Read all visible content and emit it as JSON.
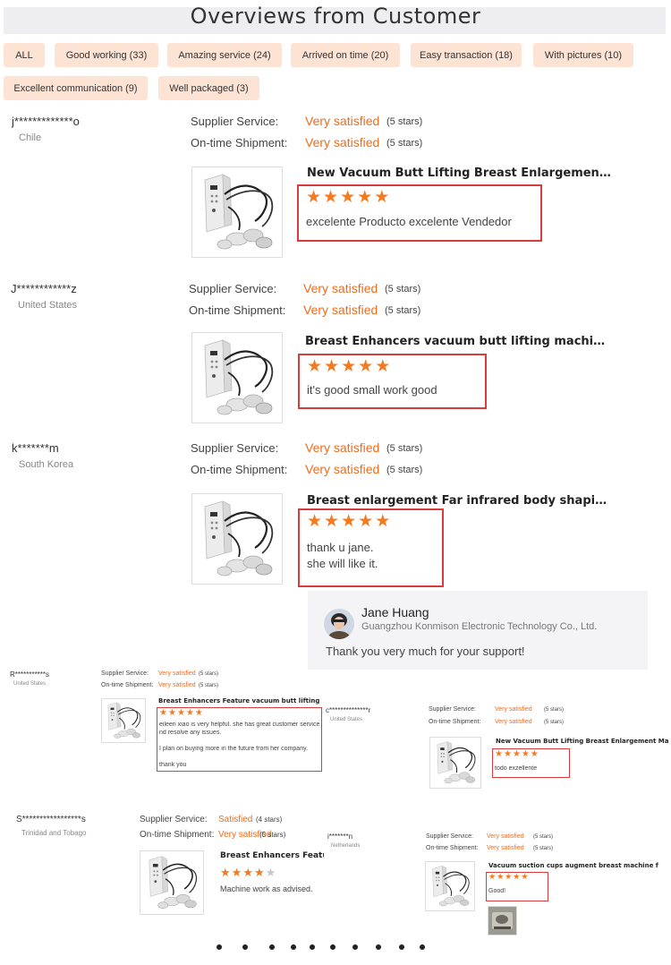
{
  "header": {
    "title": "Overviews from Customer"
  },
  "filters": [
    {
      "label": "ALL"
    },
    {
      "label": "Good working (33)"
    },
    {
      "label": "Amazing service (24)"
    },
    {
      "label": "Arrived on time (20)"
    },
    {
      "label": "Easy transaction (18)"
    },
    {
      "label": "With pictures (10)"
    },
    {
      "label": "Excellent communication (9)"
    },
    {
      "label": "Well packaged (3)"
    }
  ],
  "labels": {
    "supplier_service": "Supplier Service:",
    "ontime_shipment": "On-time Shipment:"
  },
  "reviews": [
    {
      "name": "j*************o",
      "country": "Chile",
      "supplier": "Very satisfied",
      "supplier_stars": "(5 stars)",
      "shipment": "Very satisfied",
      "shipment_stars": "(5 stars)",
      "product": "New Vacuum Butt Lifting Breast Enlargement Machin...",
      "rating": 5,
      "comment": [
        "excelente Producto  excelente  Vendedor"
      ]
    },
    {
      "name": "J************z",
      "country": "United States",
      "supplier": "Very satisfied",
      "supplier_stars": "(5 stars)",
      "shipment": "Very satisfied",
      "shipment_stars": "(5 stars)",
      "product": "Breast Enhancers vacuum butt lifting machine cups v...",
      "rating": 5,
      "comment": [
        "it's good small work good"
      ]
    },
    {
      "name": "k*******m",
      "country": "South Korea",
      "supplier": "Very satisfied",
      "supplier_stars": "(5 stars)",
      "shipment": "Very satisfied",
      "shipment_stars": "(5 stars)",
      "product": "Breast enlargement Far infrared body shaping breast ...",
      "rating": 5,
      "comment": [
        "thank u  jane.",
        "she will like it."
      ]
    }
  ],
  "reply": {
    "name": "Jane Huang",
    "company": "Guangzhou Konmison Electronic Technology Co., Ltd.",
    "message": "Thank you very much for your support!"
  },
  "small_reviews": [
    {
      "name": "R***********s",
      "country": "United States",
      "supplier": "Very satisfied",
      "supplier_stars": "(5 stars)",
      "shipment": "Very satisfied",
      "shipment_stars": "(5 stars)",
      "product": "Breast Enhancers Feature vacuum butt lifting machin...",
      "rating": 5,
      "comment": [
        "eileen xiao is very helpful.  she has great customer service a",
        "nd resolve any issues.",
        "",
        "I plan on buying more in the future from her company.",
        "",
        "thank you"
      ]
    },
    {
      "name": "c**************r",
      "country": "United States",
      "supplier": "Very satisfied",
      "supplier_stars": "(5 stars)",
      "shipment": "Very satisfied",
      "shipment_stars": "(5 stars)",
      "product": "New Vacuum Butt Lifting Breast Enlargement Machin...",
      "rating": 5,
      "comment": [
        "todo exzellente"
      ]
    },
    {
      "name": "S*****************s",
      "country": "Trinidad and Tobago",
      "supplier": "Satisfied",
      "supplier_stars": "(4 stars)",
      "shipment": "Very satisfied",
      "shipment_stars": "(5 stars)",
      "product": "Breast Enhancers Feature v",
      "rating": 4,
      "comment": [
        "Machine work as advised."
      ]
    },
    {
      "name": "i*******n",
      "country": "Netherlands",
      "supplier": "Very satisfied",
      "supplier_stars": "(5 stars)",
      "shipment": "Very satisfied",
      "shipment_stars": "(5 stars)",
      "product": "Vacuum suction cups augment breast machine fast b...",
      "rating": 5,
      "comment": [
        "Good!"
      ]
    }
  ],
  "pagination": {
    "page_count": 11
  },
  "colors": {
    "accent": "#f06b1a",
    "star": "#f47a1f",
    "highlight_box": "#d93c3c",
    "tag_bg": "#fde3d4"
  },
  "icons": {
    "star": "star-icon",
    "product": "product-thumbnail",
    "avatar": "avatar"
  }
}
